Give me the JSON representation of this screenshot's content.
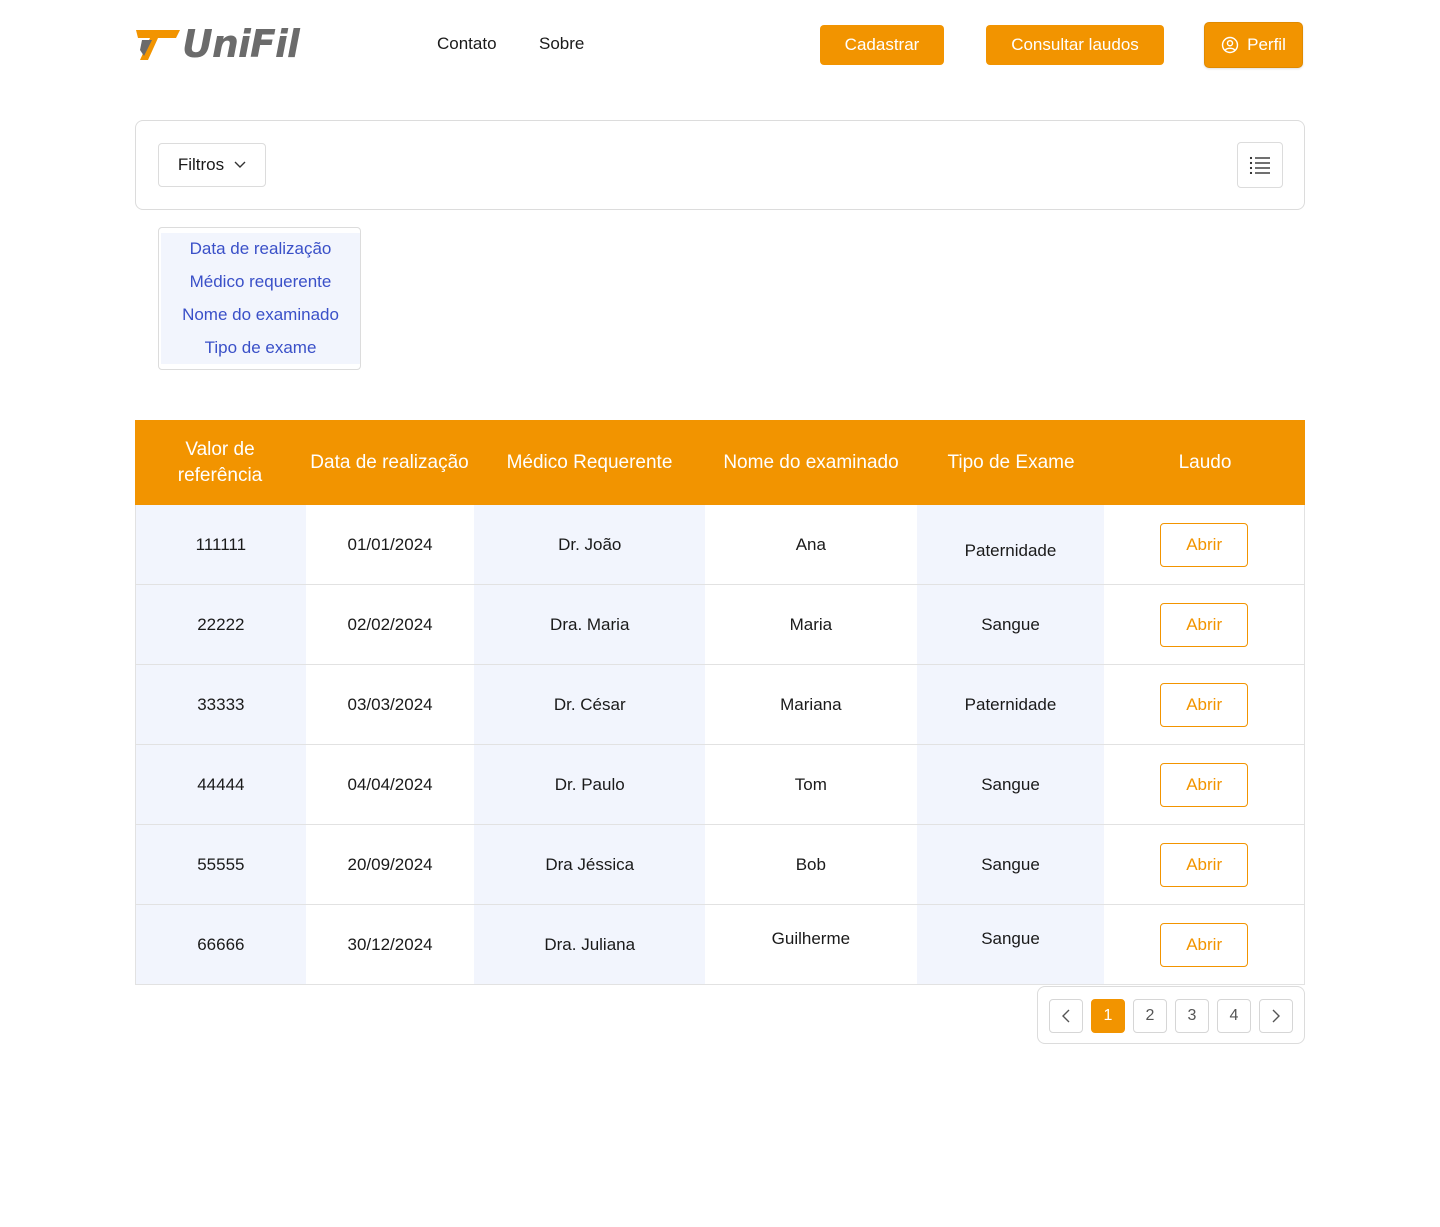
{
  "header": {
    "logo_text": "UniFil",
    "nav": [
      "Contato",
      "Sobre"
    ],
    "buttons": {
      "cadastrar": "Cadastrar",
      "consultar": "Consultar laudos",
      "perfil": "Perfil"
    }
  },
  "filters": {
    "button_label": "Filtros",
    "options": [
      "Data de realização",
      "Médico requerente",
      "Nome do examinado",
      "Tipo de exame"
    ]
  },
  "table": {
    "headers": [
      "Valor de referência",
      "Data de realização",
      "Médico Requerente",
      "Nome do examinado",
      "Tipo de Exame",
      "Laudo"
    ],
    "rows": [
      {
        "ref": "111111",
        "date": "01/01/2024",
        "doctor": "Dr. João",
        "name": "Ana",
        "type": "Paternidade",
        "action": "Abrir"
      },
      {
        "ref": "22222",
        "date": "02/02/2024",
        "doctor": "Dra. Maria",
        "name": "Maria",
        "type": "Sangue",
        "action": "Abrir"
      },
      {
        "ref": "33333",
        "date": "03/03/2024",
        "doctor": "Dr. César",
        "name": "Mariana",
        "type": "Paternidade",
        "action": "Abrir"
      },
      {
        "ref": "44444",
        "date": "04/04/2024",
        "doctor": "Dr. Paulo",
        "name": "Tom",
        "type": "Sangue",
        "action": "Abrir"
      },
      {
        "ref": "55555",
        "date": "20/09/2024",
        "doctor": "Dra Jéssica",
        "name": "Bob",
        "type": "Sangue",
        "action": "Abrir"
      },
      {
        "ref": "66666",
        "date": "30/12/2024",
        "doctor": "Dra. Juliana",
        "name": "Guilherme",
        "type": "Sangue",
        "action": "Abrir"
      }
    ]
  },
  "pagination": {
    "pages": [
      "1",
      "2",
      "3",
      "4"
    ],
    "current": "1"
  },
  "colors": {
    "accent": "#f29400",
    "link": "#3a50c8",
    "shade": "#f2f5fd"
  }
}
